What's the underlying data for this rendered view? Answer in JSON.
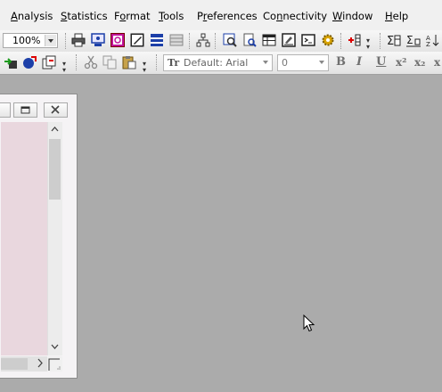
{
  "menubar": {
    "items": [
      {
        "label": "Analysis",
        "accel": "A",
        "rest": "nalysis"
      },
      {
        "label": "Statistics",
        "accel": "S",
        "rest": "tatistics"
      },
      {
        "label": "Format",
        "accel": "o",
        "pre": "F",
        "rest": "rmat"
      },
      {
        "label": "Tools",
        "accel": "T",
        "rest": "ools"
      },
      {
        "label": "Preferences",
        "accel": "r",
        "pre": "P",
        "rest": "eferences"
      },
      {
        "label": "Connectivity",
        "accel": "n",
        "pre": "Co",
        "rest": "nectivity"
      },
      {
        "label": "Window",
        "accel": "W",
        "rest": "indow"
      },
      {
        "label": "Help",
        "accel": "H",
        "rest": "elp"
      }
    ]
  },
  "toolbar_standard": {
    "zoom_value": "100%"
  },
  "toolbar_format": {
    "font_name": "Default: Arial",
    "font_size": "0",
    "bold_label": "B",
    "italic_label": "I",
    "underline_label": "U",
    "superscript_label": "x²",
    "subscript_label": "x₂",
    "extra_label": "x"
  },
  "colors": {
    "workspace": "#ababab",
    "document_bg": "#e9d7de",
    "accent_blue": "#1c3fa8",
    "accent_magenta": "#c0139a"
  },
  "icons": [
    "print-icon",
    "preview-icon",
    "graph-icon",
    "notes-icon",
    "layout-icon",
    "tree-icon",
    "search-icon",
    "table-icon",
    "script-icon",
    "terminal-icon",
    "gear-icon",
    "add-column-icon",
    "sum-icon",
    "sort-icon"
  ]
}
